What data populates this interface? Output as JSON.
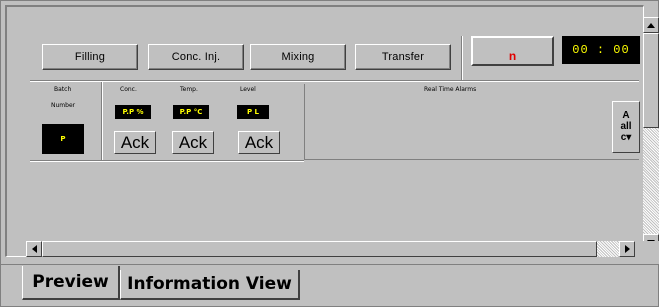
{
  "process_buttons": [
    "Filling",
    "Conc. Inj.",
    "Mixing",
    "Transfer"
  ],
  "alarm_indicator": "n",
  "clock": "00 : 00",
  "batch": {
    "label_line1": "Batch",
    "label_line2": "Number",
    "value": "P"
  },
  "meters": [
    {
      "label": "Conc.",
      "value": "P.P %",
      "ack": "Ack"
    },
    {
      "label": "Temp.",
      "value": "P.P °C",
      "ack": "Ack"
    },
    {
      "label": "Level",
      "value": "P L",
      "ack": "Ack"
    }
  ],
  "alarms": {
    "title": "Real Time Alarms",
    "side_button": "A\nall\nc▾"
  },
  "tabs": {
    "preview": "Preview",
    "information": "Information View"
  }
}
